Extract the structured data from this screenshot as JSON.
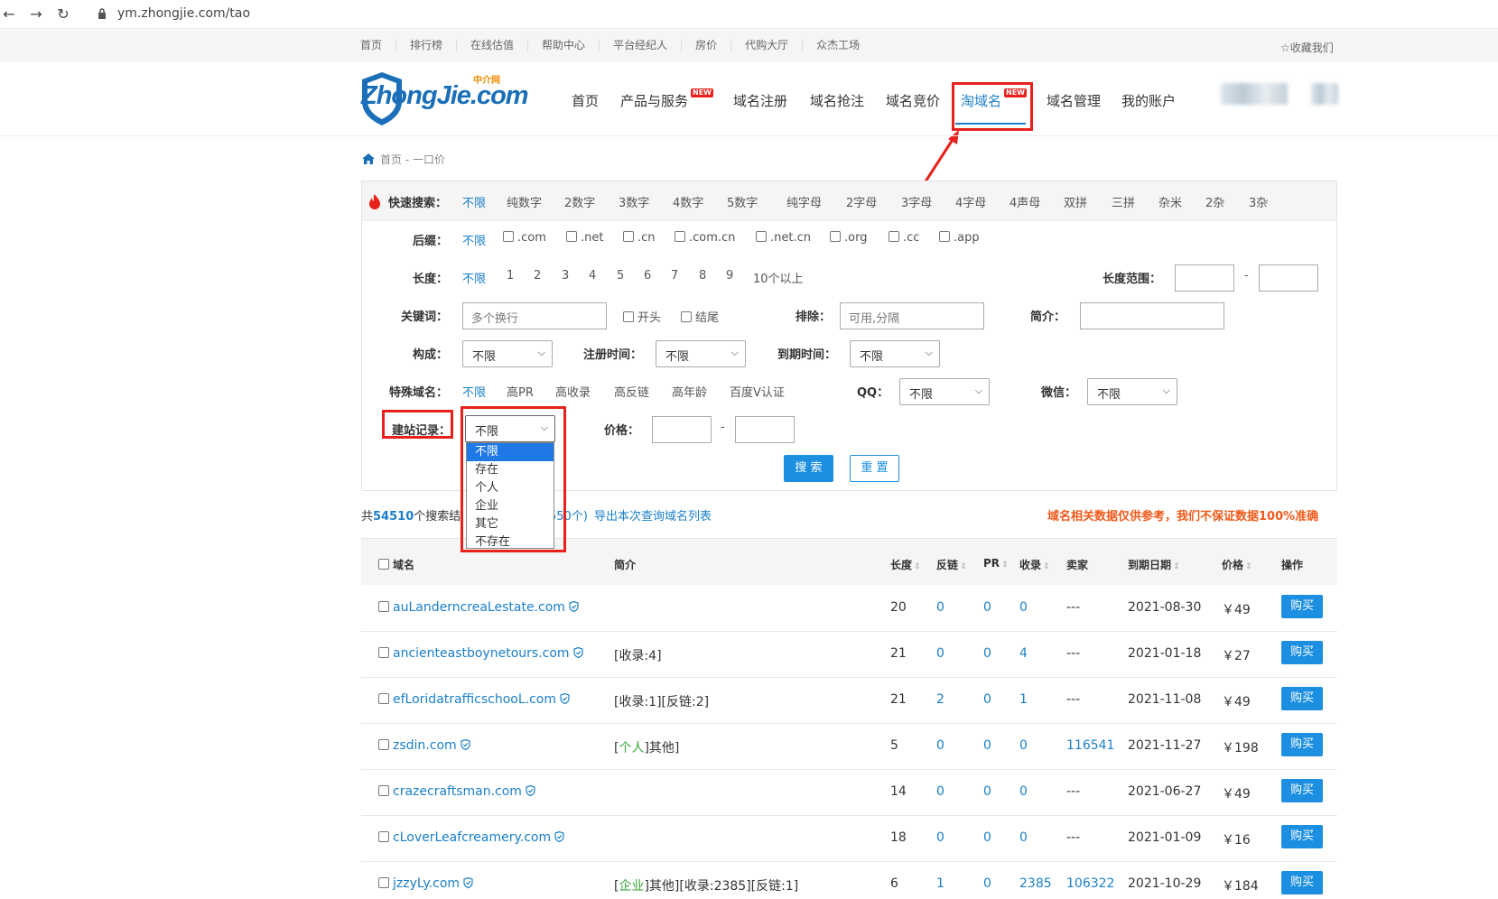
{
  "browser": {
    "url": "ym.zhongjie.com/tao"
  },
  "topnav": {
    "links": [
      "首页",
      "排行榜",
      "在线估值",
      "帮助中心",
      "平台经纪人",
      "房价",
      "代购大厅",
      "众杰工场"
    ],
    "favorite": "☆收藏我们"
  },
  "header": {
    "logo_text": "ZhongJie.com",
    "logo_small": "中介网",
    "nav": [
      "首页",
      "产品与服务",
      "域名注册",
      "域名抢注",
      "域名竞价",
      "淘域名",
      "域名管理",
      "我的账户"
    ],
    "new_badge": "NEW"
  },
  "breadcrumb": {
    "home": "首页",
    "sep": " - ",
    "current": "一口价"
  },
  "filters": {
    "quick_label": "快速搜索：",
    "quick_options": [
      "不限",
      "纯数字",
      "2数字",
      "3数字",
      "4数字",
      "5数字",
      "纯字母",
      "2字母",
      "3字母",
      "4字母",
      "4声母",
      "双拼",
      "三拼",
      "杂米",
      "2杂",
      "3杂"
    ],
    "suffix_label": "后缀：",
    "suffix_all": "不限",
    "suffix_options": [
      ".com",
      ".net",
      ".cn",
      ".com.cn",
      ".net.cn",
      ".org",
      ".cc",
      ".app"
    ],
    "length_label": "长度：",
    "length_options": [
      "不限",
      "1",
      "2",
      "3",
      "4",
      "5",
      "6",
      "7",
      "8",
      "9",
      "10个以上"
    ],
    "length_range_label": "长度范围：",
    "range_dash": "-",
    "keyword_label": "关键词：",
    "keyword_placeholder": "多个换行",
    "keyword_start": "开头",
    "keyword_end": "结尾",
    "exclude_label": "排除：",
    "exclude_placeholder": "可用,分隔",
    "intro_label": "简介：",
    "composition_label": "构成：",
    "composition_value": "不限",
    "regtime_label": "注册时间：",
    "regtime_value": "不限",
    "expire_label": "到期时间：",
    "expire_value": "不限",
    "special_label": "特殊域名：",
    "special_options": [
      "不限",
      "高PR",
      "高收录",
      "高反链",
      "高年龄",
      "百度V认证"
    ],
    "qq_label": "QQ：",
    "qq_value": "不限",
    "wechat_label": "微信：",
    "wechat_value": "不限",
    "site_record_label": "建站记录：",
    "site_record_value": "不限",
    "site_record_options": [
      "不限",
      "存在",
      "个人",
      "企业",
      "其它",
      "不存在"
    ],
    "price_label": "价格：",
    "search_button": "搜 索",
    "reset_button": "重 置"
  },
  "results": {
    "prefix": "共",
    "count": "54510",
    "middle": "个搜索结",
    "hidden_part": "550个)",
    "export_link": "导出本次查询域名列表",
    "disclaimer": "域名相关数据仅供参考，我们不保证数据100%准确"
  },
  "table": {
    "headers": {
      "domain": "域名",
      "intro": "简介",
      "length": "长度",
      "backlinks": "反链",
      "pr": "PR",
      "indexed": "收录",
      "seller": "卖家",
      "expire": "到期日期",
      "price": "价格",
      "action": "操作"
    },
    "buy_label": "购买",
    "rows": [
      {
        "domain": "auLanderncreaLestate.com",
        "intro": "",
        "length": "20",
        "backlinks": "0",
        "pr": "0",
        "indexed": "0",
        "seller": "---",
        "expire": "2021-08-30",
        "price": "￥49"
      },
      {
        "domain": "ancienteastboynetours.com",
        "intro": "[收录:4]",
        "length": "21",
        "backlinks": "0",
        "pr": "0",
        "indexed": "4",
        "seller": "---",
        "expire": "2021-01-18",
        "price": "￥27"
      },
      {
        "domain": "efLoridatrafficschooL.com",
        "intro": "[收录:1][反链:2]",
        "length": "21",
        "backlinks": "2",
        "pr": "0",
        "indexed": "1",
        "seller": "---",
        "expire": "2021-11-08",
        "price": "￥49"
      },
      {
        "domain": "zsdin.com",
        "intro_open": "[",
        "intro_green": "个人",
        "intro_rest": "]其他]",
        "length": "5",
        "backlinks": "0",
        "pr": "0",
        "indexed": "0",
        "seller": "116541",
        "expire": "2021-11-27",
        "price": "￥198"
      },
      {
        "domain": "crazecraftsman.com",
        "intro": "",
        "length": "14",
        "backlinks": "0",
        "pr": "0",
        "indexed": "0",
        "seller": "---",
        "expire": "2021-06-27",
        "price": "￥49"
      },
      {
        "domain": "cLoverLeafcreamery.com",
        "intro": "",
        "length": "18",
        "backlinks": "0",
        "pr": "0",
        "indexed": "0",
        "seller": "---",
        "expire": "2021-01-09",
        "price": "￥16"
      },
      {
        "domain": "jzzyLy.com",
        "intro_open": "[",
        "intro_green": "企业",
        "intro_rest": "]其他][收录:2385][反链:1]",
        "length": "6",
        "backlinks": "1",
        "pr": "0",
        "indexed": "2385",
        "seller": "106322",
        "expire": "2021-10-29",
        "price": "￥184"
      }
    ]
  },
  "colors": {
    "accent": "#1a7fc8",
    "highlight": "#e8211d",
    "button": "#1c8fe0",
    "warning": "#f05a1a"
  }
}
